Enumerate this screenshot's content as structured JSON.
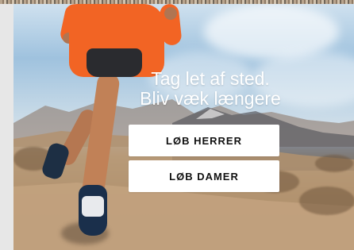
{
  "hero": {
    "headline_line1": "Tag let af sted.",
    "headline_line2": "Bliv væk længere",
    "buttons": {
      "men_label": "LØB HERRER",
      "women_label": "LØB DAMER"
    }
  }
}
